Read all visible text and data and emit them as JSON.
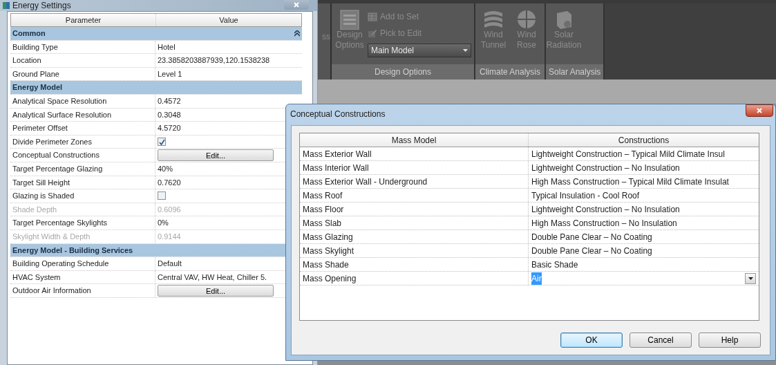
{
  "energy_settings": {
    "title": "Energy Settings",
    "columns": [
      "Parameter",
      "Value"
    ],
    "groups": [
      {
        "title": "Common",
        "collapsible": true,
        "rows": [
          {
            "kind": "text",
            "parameter": "Building Type",
            "value": "Hotel",
            "disabled": false
          },
          {
            "kind": "text",
            "parameter": "Location",
            "value": "23.3858203887939,120.1538238",
            "disabled": false
          },
          {
            "kind": "text",
            "parameter": "Ground Plane",
            "value": "Level 1",
            "disabled": false
          }
        ]
      },
      {
        "title": "Energy Model",
        "collapsible": false,
        "rows": [
          {
            "kind": "text",
            "parameter": "Analytical Space Resolution",
            "value": "0.4572",
            "disabled": false
          },
          {
            "kind": "text",
            "parameter": "Analytical Surface Resolution",
            "value": "0.3048",
            "disabled": false
          },
          {
            "kind": "text",
            "parameter": "Perimeter Offset",
            "value": "4.5720",
            "disabled": false
          },
          {
            "kind": "checkbox",
            "parameter": "Divide Perimeter Zones",
            "checked": true,
            "disabled": false
          },
          {
            "kind": "button",
            "parameter": "Conceptual Constructions",
            "value": "Edit...",
            "disabled": false
          },
          {
            "kind": "text",
            "parameter": "Target Percentage Glazing",
            "value": "40%",
            "disabled": false
          },
          {
            "kind": "text",
            "parameter": "Target Sill Height",
            "value": "0.7620",
            "disabled": false
          },
          {
            "kind": "checkbox",
            "parameter": "Glazing is Shaded",
            "checked": false,
            "disabled": false
          },
          {
            "kind": "text",
            "parameter": "Shade Depth",
            "value": "0.6096",
            "disabled": true
          },
          {
            "kind": "text",
            "parameter": "Target Percentage Skylights",
            "value": "0%",
            "disabled": false
          },
          {
            "kind": "text",
            "parameter": "Skylight Width & Depth",
            "value": "0.9144",
            "disabled": true
          }
        ]
      },
      {
        "title": "Energy Model - Building Services",
        "rows": [
          {
            "kind": "text",
            "parameter": "Building Operating Schedule",
            "value": "Default",
            "disabled": false
          },
          {
            "kind": "text",
            "parameter": "HVAC System",
            "value": "Central VAV, HW Heat, Chiller 5.",
            "disabled": false
          },
          {
            "kind": "button",
            "parameter": "Outdoor Air Information",
            "value": "Edit...",
            "disabled": false
          }
        ]
      }
    ]
  },
  "ribbon": {
    "cut_label": "ss",
    "panels": [
      {
        "label": "Design Options",
        "items": [
          {
            "kind": "large",
            "label": "Design Options",
            "disabled": true
          },
          {
            "kind": "small",
            "label": "Add to Set",
            "disabled": true
          },
          {
            "kind": "small",
            "label": "Pick to Edit",
            "disabled": true
          },
          {
            "kind": "dropdown",
            "value": "Main Model",
            "disabled": false
          }
        ]
      },
      {
        "label": "Climate Analysis",
        "items": [
          {
            "kind": "large",
            "label": "Wind Tunnel",
            "disabled": true
          },
          {
            "kind": "large",
            "label": "Wind Rose",
            "disabled": true
          }
        ]
      },
      {
        "label": "Solar Analysis",
        "items": [
          {
            "kind": "large",
            "label": "Solar Radiation",
            "disabled": true
          }
        ]
      }
    ]
  },
  "dialog": {
    "title": "Conceptual Constructions",
    "columns": [
      "Mass Model",
      "Constructions"
    ],
    "rows": [
      {
        "mass_model": "Mass Exterior Wall",
        "construction": "Lightweight Construction – Typical Mild Climate Insul",
        "selected": false
      },
      {
        "mass_model": "Mass Interior Wall",
        "construction": "Lightweight Construction – No Insulation",
        "selected": false
      },
      {
        "mass_model": "Mass Exterior Wall - Underground",
        "construction": "High Mass Construction – Typical Mild Climate Insulat",
        "selected": false
      },
      {
        "mass_model": "Mass Roof",
        "construction": "Typical Insulation - Cool Roof",
        "selected": false
      },
      {
        "mass_model": "Mass Floor",
        "construction": "Lightweight Construction – No Insulation",
        "selected": false
      },
      {
        "mass_model": "Mass Slab",
        "construction": "High Mass Construction – No Insulation",
        "selected": false
      },
      {
        "mass_model": "Mass Glazing",
        "construction": "Double Pane Clear – No Coating",
        "selected": false
      },
      {
        "mass_model": "Mass Skylight",
        "construction": "Double Pane Clear – No Coating",
        "selected": false
      },
      {
        "mass_model": "Mass Shade",
        "construction": "Basic Shade",
        "selected": false
      },
      {
        "mass_model": "Mass Opening",
        "construction": "Air",
        "selected": true
      }
    ],
    "buttons": [
      {
        "label": "OK",
        "default": true
      },
      {
        "label": "Cancel",
        "default": false
      },
      {
        "label": "Help",
        "default": false
      }
    ]
  }
}
